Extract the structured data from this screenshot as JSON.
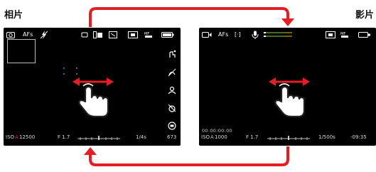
{
  "labels": {
    "photo": "相片",
    "video": "影片"
  },
  "photo_screen": {
    "top_bar": {
      "af_mode": "AFs"
    },
    "bottom_bar": {
      "iso_prefix": "ISO",
      "iso_letter": "A",
      "iso_value": "12500",
      "aperture": "F 1.7",
      "shutter": "1/4s",
      "frames": "673"
    },
    "colors": {
      "iso_accent": "#e31e24"
    }
  },
  "video_screen": {
    "top_bar": {
      "af_mode": "AFs",
      "bracket": "[·]"
    },
    "timecode": "00:00:00:00",
    "bottom_bar": {
      "iso_prefix": "ISO",
      "iso_letter": "A",
      "iso_value": "1000",
      "aperture": "F 1.7",
      "shutter": "1/500s",
      "time": "-09:35"
    },
    "colors": {
      "iso_accent": "#e8c200"
    }
  },
  "icons": [
    "camera-mode-icon",
    "af-icon",
    "flash-off-icon",
    "drive-mode-icon",
    "metering-icon",
    "battery-icon",
    "microphone-icon",
    "audio-level-icon",
    "sd-card-icon",
    "hand-swipe-icon",
    "double-arrow-icon",
    "switch-arrow-icon"
  ],
  "accent_color": "#e31e24"
}
